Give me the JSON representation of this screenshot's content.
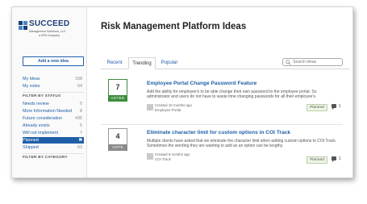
{
  "brand": {
    "name": "SUCCEED",
    "subtitle": "Management Solutions, LLC",
    "tagline": "a KPA Company",
    "color": "#1c3f74"
  },
  "page": {
    "title": "Risk Management Platform Ideas"
  },
  "sidebar": {
    "add_idea_label": "Add a new idea",
    "my_items": [
      {
        "label": "My ideas",
        "count": "158"
      },
      {
        "label": "My votes",
        "count": "54"
      }
    ],
    "status_heading": "FILTER BY STATUS",
    "statuses": [
      {
        "label": "Needs review",
        "count": "0"
      },
      {
        "label": "More Information Needed",
        "count": "8"
      },
      {
        "label": "Future consideration",
        "count": "435"
      },
      {
        "label": "Already exists",
        "count": "5"
      },
      {
        "label": "Will not implement",
        "count": "7"
      },
      {
        "label": "Planned",
        "count": "✖",
        "active": true
      },
      {
        "label": "Shipped",
        "count": "63"
      }
    ],
    "category_heading": "FILTER BY CATEGORY"
  },
  "tabs": [
    {
      "label": "Recent",
      "active": false
    },
    {
      "label": "Trending",
      "active": true
    },
    {
      "label": "Popular",
      "active": false
    }
  ],
  "search": {
    "placeholder": "Search ideas"
  },
  "ideas": [
    {
      "votes": "7",
      "vote_label": "VOTED",
      "title": "Employee Portal Change Password Feature",
      "description": "Add the ability for employee's to be able change their own password to the employee portal. So administrator and users do not have to waste time changing passwords for all their employee's.",
      "created": "Created 10 months ago",
      "category": "Employee Portal",
      "status": "Planned",
      "comments": "1"
    },
    {
      "votes": "4",
      "vote_label": "VOTE",
      "title": "Eliminate character limit for custom options in COI Track",
      "description": "Multiple clients have asked that we eliminate the character limit when adding custom options to COI Track. Sometimes the wording they are wanting to add as an option can be lengthy.",
      "created": "Created 8 months ago",
      "category": "COI Track",
      "status": "Planned",
      "comments": "1"
    }
  ],
  "colors": {
    "accent": "#1f5fa8",
    "voted": "#3d8c3d",
    "planned_bg": "#eef5e6"
  }
}
